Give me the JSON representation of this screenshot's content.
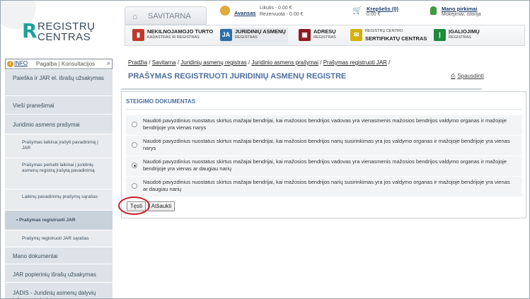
{
  "logo": {
    "line1": "REGISTRŲ",
    "line2": "CENTRAS"
  },
  "header": {
    "home_label": "SAVITARNA",
    "advance": {
      "label": "Avansas",
      "balance": "Likutis - 0.00 €",
      "reserved": "Rezervuota - 0.00 €"
    },
    "cart": {
      "label": "Krepšelis (0)",
      "amount": "0.00 €"
    },
    "purchases": {
      "label": "Mano pirkimai",
      "sub": "Mokėjimai, istorija"
    },
    "tabs": [
      {
        "title": "NEKILNOJAMOJO TURTO",
        "sub": "KADASTRAS IR REGISTRAS",
        "icon": "building-icon",
        "color": "#c0392b"
      },
      {
        "title": "JURIDINIŲ ASMENŲ",
        "sub": "REGISTRAS",
        "icon": "legal-entities-icon",
        "color": "#2e6da4"
      },
      {
        "title": "ADRESŲ",
        "sub": "REGISTRAS",
        "icon": "address-icon",
        "color": "#8e1b22"
      },
      {
        "title": "SERTIFIKATŲ CENTRAS",
        "sub": "REGISTRŲ CENTRO",
        "icon": "certificate-icon",
        "color": "#d4b10a"
      },
      {
        "title": "ĮGALIOJIMŲ",
        "sub": "REGISTRAS",
        "icon": "authorization-icon",
        "color": "#1e8a3c"
      }
    ]
  },
  "search": {
    "info": "INFO",
    "help": "Pagalba",
    "consult": "Konsultacijos"
  },
  "sidebar": [
    {
      "label": "Paieška ir JAR el. išrašų užsakymas"
    },
    {
      "label": "Vieši pranešimai"
    },
    {
      "label": "Juridinio asmens prašymai"
    },
    {
      "label": "Prašymas laikinai įrašyti pavadinimą į JAR"
    },
    {
      "label": "Prašymas perkelti laikinai į juridinių asmenų registrą įrašytą pavadinimą"
    },
    {
      "label": "Laikinų pavadinimų prašymų sąrašas"
    },
    {
      "label": "• Prašymas registruoti JAR"
    },
    {
      "label": "Prašymų registruoti JAR sąrašas"
    },
    {
      "label": "Mano dokumentai"
    },
    {
      "label": "JAR popierinių išrašų užsakymas"
    },
    {
      "label": "JADIS - Juridinių asmenų dalyvių informacinė sistema"
    }
  ],
  "breadcrumb": {
    "items": [
      "Pradžia",
      "Savitarna",
      "Juridinių asmenų registras",
      "Juridinio asmens prašymai",
      "Prašymas registruoti JAR"
    ],
    "sep": " / "
  },
  "page": {
    "title": "PRAŠYMAS REGISTRUOTI JURIDINIŲ ASMENŲ REGISTRE",
    "print": "Spausdinti"
  },
  "form": {
    "section_title": "STEIGIMO DOKUMENTAS",
    "options": [
      {
        "text": "Naudoti pavyzdinius nuostatus skirtus mažajai bendrijai, kai mažosios bendrijos vadovas yra vienasmenis mažosios bendrijos valdymo organas ir mažojoje bendrijoje yra vienas narys",
        "selected": false
      },
      {
        "text": "Naudoti pavyzdinius nuostatus skirtus mažajai bendrijai, kai mažosios bendrijos narių susirinkimas yra jos valdymo organas ir mažojoje bendrijoje yra vienas narys",
        "selected": false
      },
      {
        "text": "Naudoti pavyzdinius nuostatus skirtus mažajai bendrijai, kai mažosios bendrijos vadovas yra vienasmenis mažosios bendrijos valdymo organas ir mažojoje bendrijoje yra vienas ar daugiau narių",
        "selected": true
      },
      {
        "text": "Naudoti pavyzdinius nuostatus skirtus mažajai bendrijai, kai mažosios bendrijos narių susirinkimas yra jos valdymo organas ir mažojoje bendrijoje yra vienas ar daugiau narių",
        "selected": false
      }
    ],
    "continue_label": "Tęsti",
    "cancel_label": "Atšaukti"
  }
}
